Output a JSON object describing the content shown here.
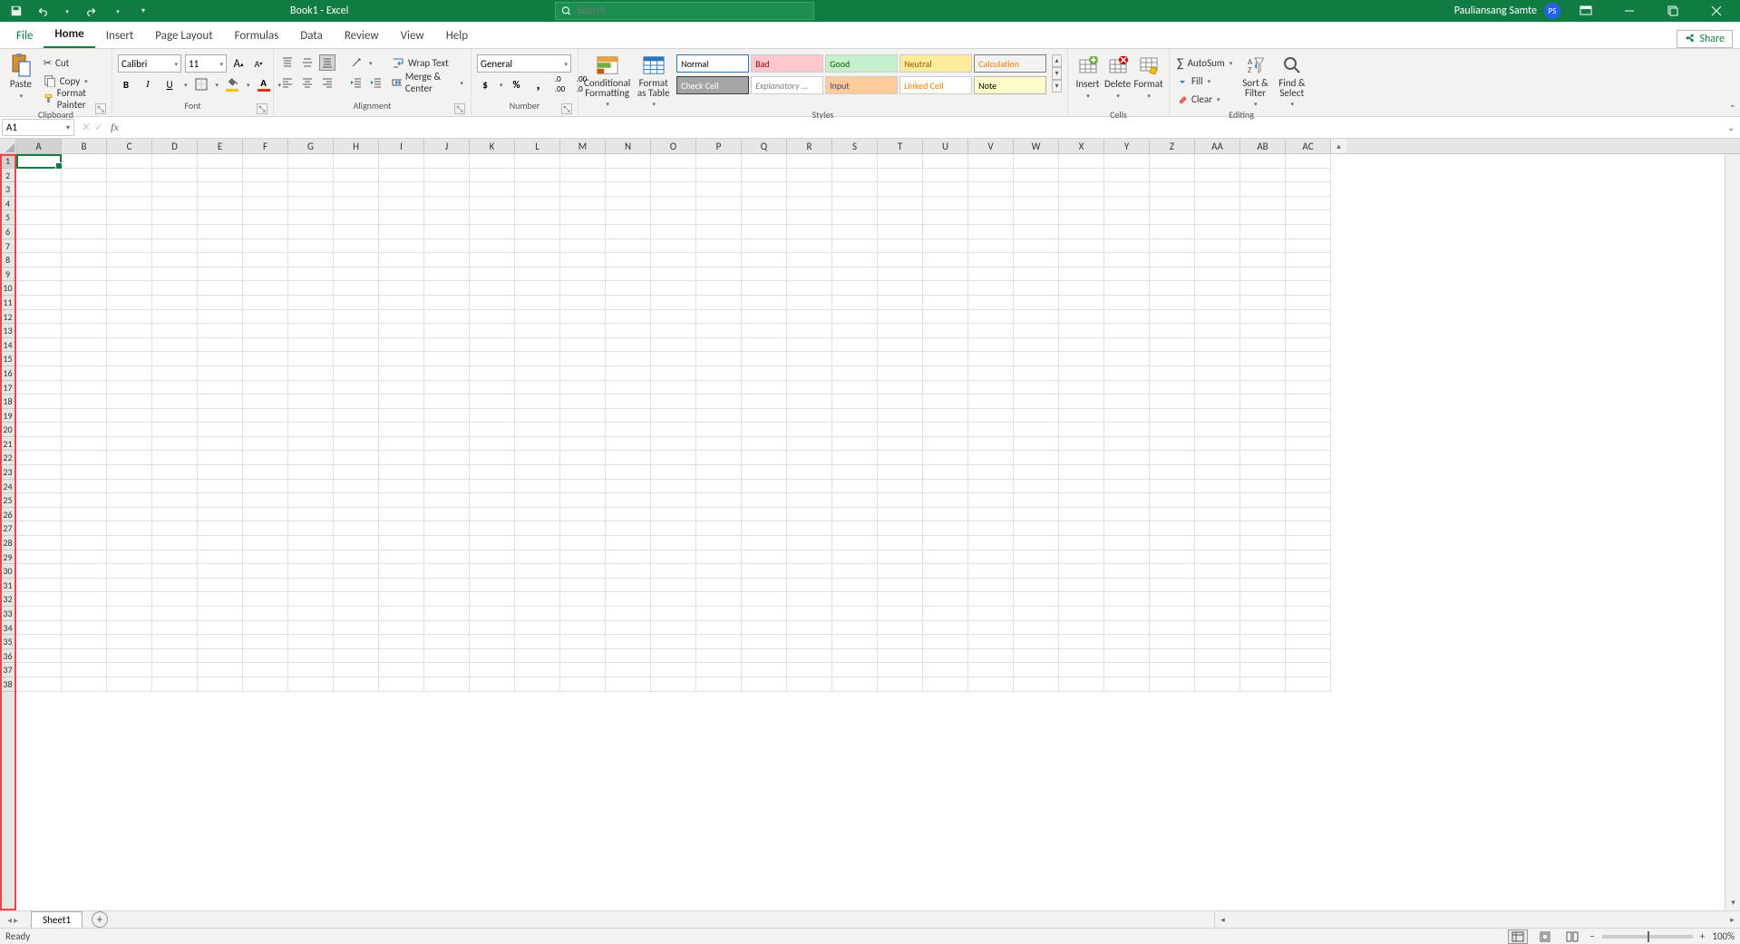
{
  "title": "Book1  -  Excel",
  "search_placeholder": "Search",
  "user": {
    "name": "Pauliansang Samte",
    "initials": "PS"
  },
  "tabs": [
    "File",
    "Home",
    "Insert",
    "Page Layout",
    "Formulas",
    "Data",
    "Review",
    "View",
    "Help"
  ],
  "active_tab": "Home",
  "share_label": "Share",
  "clipboard": {
    "cut": "Cut",
    "copy": "Copy",
    "format_painter": "Format Painter",
    "paste": "Paste",
    "group": "Clipboard"
  },
  "font": {
    "name": "Calibri",
    "size": "11",
    "group": "Font"
  },
  "alignment": {
    "wrap": "Wrap Text",
    "merge": "Merge & Center",
    "group": "Alignment"
  },
  "number": {
    "format": "General",
    "group": "Number"
  },
  "styles": {
    "cond": "Conditional Formatting",
    "table": "Format as Table",
    "cells": [
      {
        "label": "Normal",
        "bg": "#fff",
        "color": "#000"
      },
      {
        "label": "Bad",
        "bg": "#ffc7ce",
        "color": "#9c0006"
      },
      {
        "label": "Good",
        "bg": "#c6efce",
        "color": "#006100"
      },
      {
        "label": "Neutral",
        "bg": "#ffeb9c",
        "color": "#9c5700"
      },
      {
        "label": "Calculation",
        "bg": "#f2f2f2",
        "color": "#fa7d00",
        "border": "1px solid #7f7f7f"
      },
      {
        "label": "Check Cell",
        "bg": "#a5a5a5",
        "color": "#fff",
        "border": "1px solid #3f3f3f"
      },
      {
        "label": "Explanatory ...",
        "bg": "#fff",
        "color": "#7f7f7f",
        "fontStyle": "italic"
      },
      {
        "label": "Input",
        "bg": "#ffcc99",
        "color": "#3f3f76"
      },
      {
        "label": "Linked Cell",
        "bg": "#fff",
        "color": "#fa7d00"
      },
      {
        "label": "Note",
        "bg": "#ffffcc",
        "color": "#000",
        "border": "1px solid #b2b2b2"
      }
    ],
    "group": "Styles"
  },
  "cells_group": {
    "insert": "Insert",
    "delete": "Delete",
    "format": "Format",
    "group": "Cells"
  },
  "editing": {
    "autosum": "AutoSum",
    "fill": "Fill",
    "clear": "Clear",
    "sort": "Sort & Filter",
    "find": "Find & Select",
    "group": "Editing"
  },
  "namebox": "A1",
  "columns": [
    "A",
    "B",
    "C",
    "D",
    "E",
    "F",
    "G",
    "H",
    "I",
    "J",
    "K",
    "L",
    "M",
    "N",
    "O",
    "P",
    "Q",
    "R",
    "S",
    "T",
    "U",
    "V",
    "W",
    "X",
    "Y",
    "Z",
    "AA",
    "AB",
    "AC"
  ],
  "rows": 38,
  "active_cell": "A1",
  "sheet": "Sheet1",
  "status": "Ready",
  "zoom": "100%"
}
